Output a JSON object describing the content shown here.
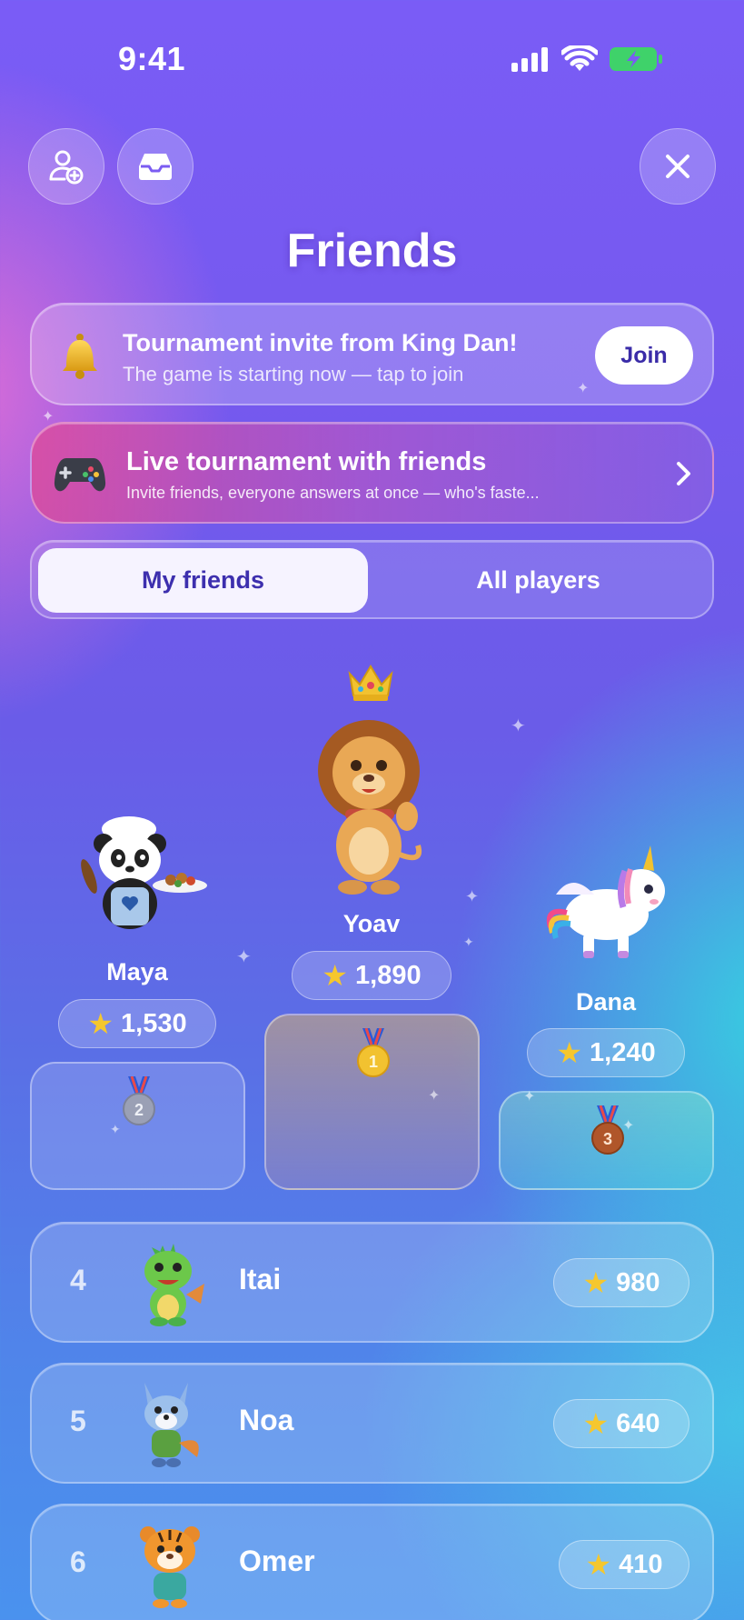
{
  "status_bar": {
    "time": "9:41"
  },
  "header": {
    "title": "Friends"
  },
  "invite_banner": {
    "title": "Tournament invite from King Dan!",
    "subtitle": "The game is starting now — tap to join",
    "join_label": "Join"
  },
  "live_banner": {
    "title": "Live tournament with friends",
    "subtitle": "Invite friends, everyone answers at once — who's faste..."
  },
  "tabs": {
    "active": "My friends",
    "other": "All players"
  },
  "podium": {
    "first": {
      "name": "Yoav",
      "score": "1,890",
      "rank": "1"
    },
    "second": {
      "name": "Maya",
      "score": "1,530",
      "rank": "2"
    },
    "third": {
      "name": "Dana",
      "score": "1,240",
      "rank": "3"
    }
  },
  "leaderboard": [
    {
      "rank": "4",
      "name": "Itai",
      "score": "980"
    },
    {
      "rank": "5",
      "name": "Noa",
      "score": "640"
    },
    {
      "rank": "6",
      "name": "Omer",
      "score": "410"
    }
  ],
  "icons": {
    "add_friend": "add-friend-icon",
    "inbox": "inbox-icon",
    "close": "close-icon",
    "bell": "bell-icon",
    "gamepad": "gamepad-icon",
    "chevron": "chevron-right-icon",
    "star": "star-icon",
    "crown": "crown-icon",
    "medal": "medal-icon"
  },
  "colors": {
    "accent_text": "#3d2fae",
    "gold": "#f2c230",
    "silver": "#9aa0b5",
    "bronze": "#b0562a"
  }
}
